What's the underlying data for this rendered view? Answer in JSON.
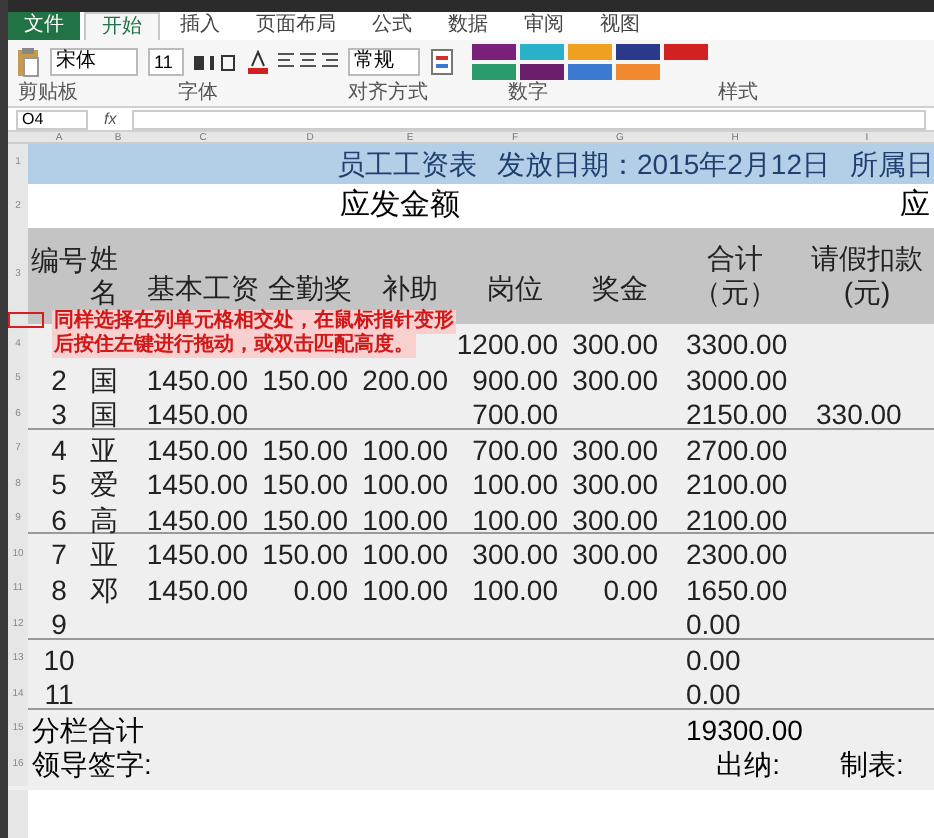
{
  "ribbon": {
    "file_tab": "文件",
    "tabs": [
      {
        "label": "开始",
        "selected": true
      },
      {
        "label": "插入",
        "selected": false
      },
      {
        "label": "页面布局",
        "selected": false
      },
      {
        "label": "公式",
        "selected": false
      },
      {
        "label": "数据",
        "selected": false
      },
      {
        "label": "审阅",
        "selected": false
      },
      {
        "label": "视图",
        "selected": false
      }
    ],
    "font_name": "宋体",
    "font_size": "11",
    "number_format": "常规",
    "style_tiles": [
      {
        "color": "#7a1f7a"
      },
      {
        "color": "#2ab0c8"
      },
      {
        "color": "#f0a020"
      },
      {
        "color": "#2a3a8a"
      },
      {
        "color": "#d02020"
      },
      {
        "color": "#2a9a6a"
      },
      {
        "color": "#6a1f6a"
      },
      {
        "color": "#3a7ad0"
      },
      {
        "color": "#f08a30"
      }
    ],
    "groups": [
      "剪贴板",
      "字体",
      "对齐方式",
      "数字",
      "样式"
    ]
  },
  "formula_bar": {
    "name_box": "O4",
    "fx": "fx"
  },
  "sheet": {
    "column_letters": [
      "A",
      "B",
      "C",
      "D",
      "E",
      "F",
      "G",
      "H",
      "I"
    ],
    "row_numbers": [
      "1",
      "2",
      "3",
      "4",
      "5",
      "6",
      "7",
      "8",
      "9",
      "10",
      "11",
      "12",
      "13",
      "14",
      "15",
      "16"
    ],
    "title": [
      "员工工资表",
      "发放日期：2015年2月12日",
      "所属日"
    ],
    "section": [
      "应发金额",
      "应"
    ],
    "headers": [
      "编号",
      "姓名",
      "基本工资",
      "全勤奖",
      "补助",
      "岗位",
      "奖金",
      "合计（元）",
      "请假扣款(元)"
    ],
    "rows": [
      {
        "kind": "data",
        "cells": [
          null,
          null,
          null,
          null,
          null,
          "1200.00",
          "300.00",
          "3300.00",
          null
        ]
      },
      {
        "kind": "data",
        "cells": [
          "2",
          "国",
          "1450.00",
          "150.00",
          "200.00",
          "900.00",
          "300.00",
          "3000.00",
          null
        ]
      },
      {
        "kind": "data",
        "cells": [
          "3",
          "国",
          "1450.00",
          null,
          null,
          "700.00",
          null,
          "2150.00",
          "330.00"
        ]
      },
      {
        "kind": "data",
        "cells": [
          "4",
          "亚",
          "1450.00",
          "150.00",
          "100.00",
          "700.00",
          "300.00",
          "2700.00",
          null
        ]
      },
      {
        "kind": "data",
        "cells": [
          "5",
          "爱",
          "1450.00",
          "150.00",
          "100.00",
          "100.00",
          "300.00",
          "2100.00",
          null
        ]
      },
      {
        "kind": "data",
        "cells": [
          "6",
          "高",
          "1450.00",
          "150.00",
          "100.00",
          "100.00",
          "300.00",
          "2100.00",
          null
        ]
      },
      {
        "kind": "data",
        "cells": [
          "7",
          "亚",
          "1450.00",
          "150.00",
          "100.00",
          "300.00",
          "300.00",
          "2300.00",
          null
        ]
      },
      {
        "kind": "data",
        "cells": [
          "8",
          "邓",
          "1450.00",
          "0.00",
          "100.00",
          "100.00",
          "0.00",
          "1650.00",
          null
        ]
      },
      {
        "kind": "data",
        "cells": [
          "9",
          null,
          null,
          null,
          null,
          null,
          null,
          "0.00",
          null
        ]
      },
      {
        "kind": "data",
        "cells": [
          "10",
          null,
          null,
          null,
          null,
          null,
          null,
          "0.00",
          null
        ]
      },
      {
        "kind": "data",
        "cells": [
          "11",
          null,
          null,
          null,
          null,
          null,
          null,
          "0.00",
          null
        ]
      },
      {
        "kind": "subtotal",
        "label": "分栏合计",
        "total": "19300.00"
      },
      {
        "kind": "signature",
        "labels": [
          "领导签字:",
          "出纳:",
          "制表:"
        ]
      }
    ],
    "tooltip": [
      "同样选择在列单元格相交处，在鼠标指针变形",
      "后按住左键进行拖动，或双击匹配高度。"
    ]
  }
}
